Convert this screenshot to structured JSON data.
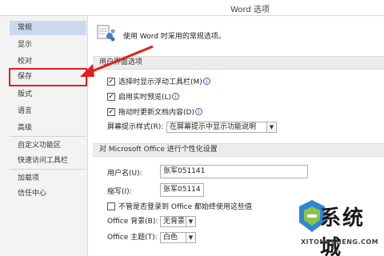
{
  "window": {
    "title": "Word 选项"
  },
  "sidebar": {
    "items": [
      {
        "label": "常规"
      },
      {
        "label": "显示"
      },
      {
        "label": "校对"
      },
      {
        "label": "保存"
      },
      {
        "label": "版式"
      },
      {
        "label": "语言"
      },
      {
        "label": "高级"
      },
      {
        "label": "自定义功能区"
      },
      {
        "label": "快速访问工具栏"
      },
      {
        "label": "加载项"
      },
      {
        "label": "信任中心"
      }
    ]
  },
  "main": {
    "header_text": "使用 Word 时采用的常规选项。",
    "ui_section": {
      "title": "用户界面选项",
      "options": [
        {
          "label": "选择时显示浮动工具栏(M)",
          "checked": true
        },
        {
          "label": "启用实时预览(L)",
          "checked": true
        },
        {
          "label": "拖动时更新文档内容(D)",
          "checked": true
        }
      ],
      "tooltip_style_label": "屏幕提示样式(R):",
      "tooltip_style_value": "在屏幕提示中显示功能说明"
    },
    "personalize_section": {
      "title": "对 Microsoft Office 进行个性化设置",
      "username_label": "用户名(U):",
      "username_value": "张军051141",
      "initials_label": "缩写(I):",
      "initials_value": "张军05114",
      "always_use_label": "不管是否登录到 Office 都始终使用这些值",
      "always_use_checked": false,
      "background_label": "Office 背景(B):",
      "background_value": "无背景",
      "theme_label": "Office 主题(T):",
      "theme_value": "白色"
    }
  },
  "watermark": {
    "text": "系统城",
    "url": "XITONGCHENG.COM"
  },
  "colors": {
    "selected_bg": "#c9d9ee",
    "highlight_border": "#e31d1d",
    "arrow": "#e31d1d"
  }
}
